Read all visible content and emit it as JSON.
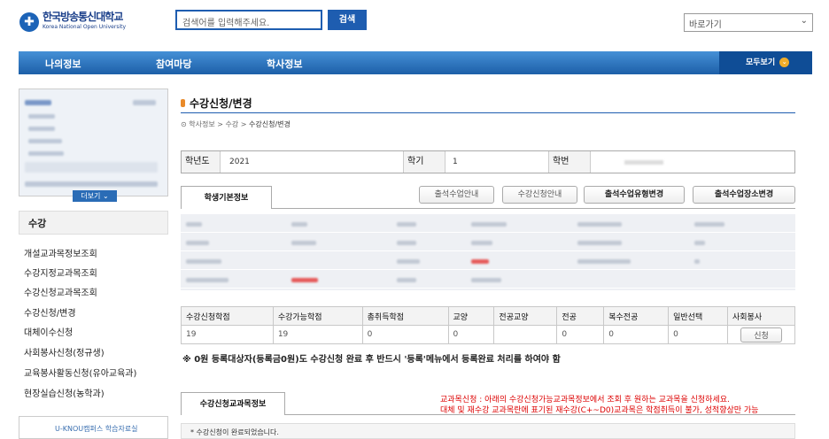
{
  "header": {
    "logo_ko": "한국방송통신대학교",
    "logo_en": "Korea National Open University",
    "search_placeholder": "검색어를 입력해주세요.",
    "search_btn": "검색",
    "goto": "바로가기"
  },
  "nav": {
    "items": [
      "나의정보",
      "참여마당",
      "학사정보"
    ],
    "all": "모두보기"
  },
  "sidebar": {
    "more": "더보기",
    "section": "수강",
    "items": [
      "개설교과목정보조회",
      "수강지정교과목조회",
      "수강신청교과목조회",
      "수강신청/변경",
      "대체이수신청",
      "사회봉사신청(정규생)",
      "교육봉사활동신청(유아교육과)",
      "현장실습신청(농학과)"
    ],
    "banner": "U-KNOU캠퍼스 학습자료실"
  },
  "main": {
    "title": "수강신청/변경",
    "breadcrumb": [
      "학사정보",
      "수강",
      "수강신청/변경"
    ],
    "info": {
      "year_label": "학년도",
      "year": "2021",
      "sem_label": "학기",
      "sem": "1",
      "id_label": "학번"
    },
    "tab_basic": "학생기본정보",
    "buttons": [
      "출석수업안내",
      "수강신청안내",
      "출석수업유형변경",
      "출석수업장소변경"
    ],
    "credit_table": {
      "headers": [
        "수강신청학점",
        "수강가능학점",
        "총취득학점",
        "교양",
        "전공교양",
        "전공",
        "복수전공",
        "일반선택",
        "사회봉사"
      ],
      "values": [
        "19",
        "19",
        "0",
        "0",
        "",
        "0",
        "0",
        "0"
      ],
      "apply_btn": "신청"
    },
    "notice": "※ 0원 등록대상자(등록금0원)도 수강신청 완료 후 반드시 '등록'메뉴에서 등록완료 처리를 하여야 함",
    "tab_courses": "수강신청교과목정보",
    "red_note1_a": "교과목신청 : 아래의 수강신청가능교과목정보에서 조회 후 원하는 교과목을 신청하세요.",
    "red_note2": "대체 및 재수강 교과목란에 표기된 재수강(C+~D0)교과목은 학점취득이 불가, 성적향상만 가능",
    "done": "* 수강신청이 완료되었습니다."
  },
  "colors": {
    "brand": "#1e5db0",
    "accent": "#f0ad2a",
    "warn": "#dd0000"
  }
}
